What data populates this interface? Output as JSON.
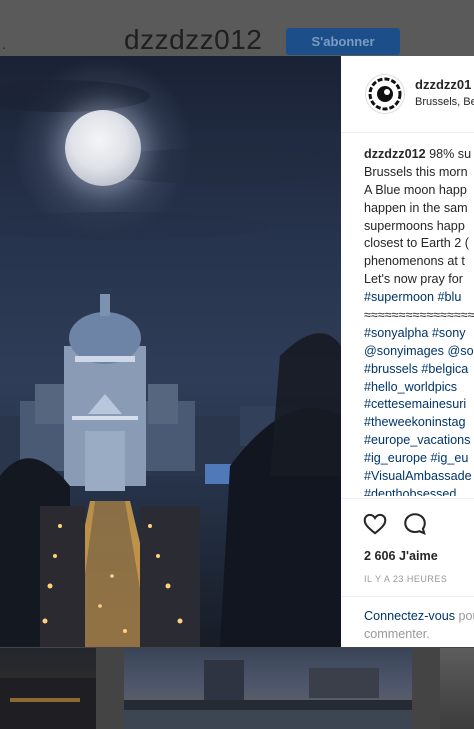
{
  "background_page": {
    "username": "dzzdzz012",
    "follow_button": "S'abonner"
  },
  "post": {
    "header": {
      "username": "dzzdzz01",
      "location": "Brussels, Be"
    },
    "caption_lines": [
      {
        "text": "98% su",
        "kind": "first"
      },
      {
        "text": "Brussels this morn",
        "kind": "text"
      },
      {
        "text": "A Blue moon happ",
        "kind": "text"
      },
      {
        "text": "happen in the sam",
        "kind": "text"
      },
      {
        "text": "supermoons happ",
        "kind": "text"
      },
      {
        "text": "closest to Earth 2 (",
        "kind": "text"
      },
      {
        "text": "phenomenons at t",
        "kind": "text"
      },
      {
        "text": "Let's now pray for",
        "kind": "text"
      },
      {
        "text": "#supermoon #blu",
        "kind": "tag"
      },
      {
        "text": "≈≈≈≈≈≈≈≈≈≈≈≈≈≈≈≈≈≈",
        "kind": "text"
      },
      {
        "text": "#sonyalpha #sony",
        "kind": "tag"
      },
      {
        "text": "@sonyimages @so",
        "kind": "tag"
      },
      {
        "text": "#brussels #belgica",
        "kind": "tag"
      },
      {
        "text": "#hello_worldpics",
        "kind": "tag"
      },
      {
        "text": "#cettesemainesuri",
        "kind": "tag"
      },
      {
        "text": "#theweekoninstag",
        "kind": "tag"
      },
      {
        "text": "#europe_vacations",
        "kind": "tag"
      },
      {
        "text": "#ig_europe #ig_eu",
        "kind": "tag"
      },
      {
        "text": "#VisualAmbassade",
        "kind": "tag"
      },
      {
        "text": "#depthobsessed",
        "kind": "tag"
      }
    ],
    "caption_user": "dzzdzz012",
    "likes": "2 606 J'aime",
    "time": "IL Y A 23 HEURES",
    "login_prompt": {
      "link": "Connectez-vous",
      "rest": " pour aimer ou",
      "line2": "commenter."
    },
    "icons": {
      "like": "heart-icon",
      "comment": "comment-icon"
    }
  }
}
